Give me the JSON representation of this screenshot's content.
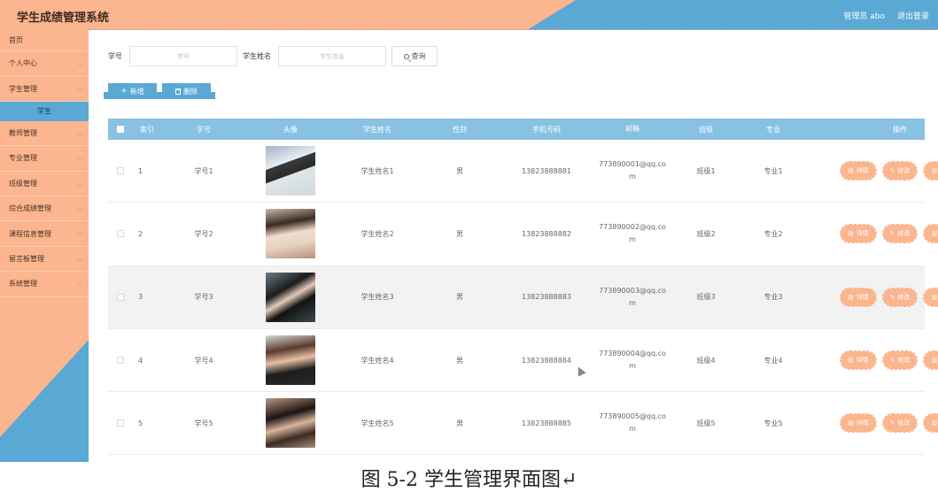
{
  "header": {
    "title": "学生成绩管理系统",
    "user_label": "管理员 abo",
    "logout_label": "退出登录",
    "colors": {
      "salmon": "#fbb58f",
      "blue": "#5aa9d4"
    }
  },
  "sidebar": {
    "items": [
      {
        "label": "首页"
      },
      {
        "label": "个人中心"
      },
      {
        "label": "学生管理"
      },
      {
        "label": "教师管理"
      },
      {
        "label": "专业管理"
      },
      {
        "label": "班级管理"
      },
      {
        "label": "综合成绩管理"
      },
      {
        "label": "课程信息管理"
      },
      {
        "label": "留言板管理"
      },
      {
        "label": "系统管理"
      }
    ],
    "submenu_active": "学生"
  },
  "search": {
    "no_label": "学号",
    "no_placeholder": "学号",
    "name_label": "学生姓名",
    "name_placeholder": "学生姓名",
    "query_label": "查询"
  },
  "actions": {
    "add_label": "新增",
    "delete_label": "删除"
  },
  "table": {
    "headers": {
      "index": "索引",
      "no": "学号",
      "avatar": "头像",
      "name": "学生姓名",
      "sex": "性别",
      "phone": "手机号码",
      "email": "邮箱",
      "class": "班级",
      "major": "专业",
      "ops": "操作"
    },
    "op_labels": {
      "detail": "详情",
      "edit": "修改",
      "delete": "删除"
    },
    "rows": [
      {
        "index": "1",
        "no": "学号1",
        "name": "学生姓名1",
        "sex": "男",
        "phone": "13823888881",
        "email_a": "773890001@qq.co",
        "email_b": "m",
        "class": "班级1",
        "major": "专业1"
      },
      {
        "index": "2",
        "no": "学号2",
        "name": "学生姓名2",
        "sex": "男",
        "phone": "13823888882",
        "email_a": "773890002@qq.co",
        "email_b": "m",
        "class": "班级2",
        "major": "专业2"
      },
      {
        "index": "3",
        "no": "学号3",
        "name": "学生姓名3",
        "sex": "男",
        "phone": "13823888883",
        "email_a": "773890003@qq.co",
        "email_b": "m",
        "class": "班级3",
        "major": "专业3"
      },
      {
        "index": "4",
        "no": "学号4",
        "name": "学生姓名4",
        "sex": "男",
        "phone": "13823888884",
        "email_a": "773890004@qq.co",
        "email_b": "m",
        "class": "班级4",
        "major": "专业4"
      },
      {
        "index": "5",
        "no": "学号5",
        "name": "学生姓名5",
        "sex": "男",
        "phone": "13823888885",
        "email_a": "773890005@qq.co",
        "email_b": "m",
        "class": "班级5",
        "major": "专业5"
      }
    ]
  },
  "caption": "图 5-2 学生管理界面图↵"
}
